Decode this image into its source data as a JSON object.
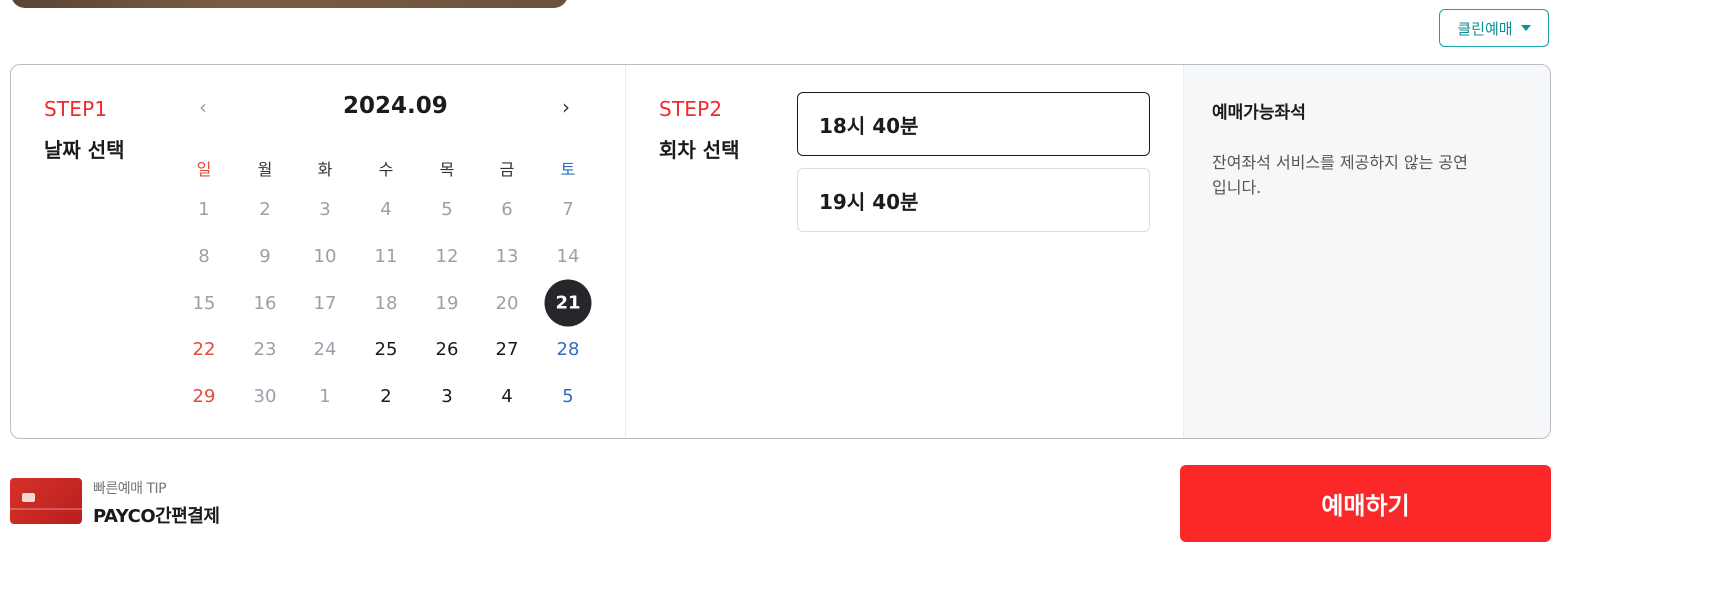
{
  "header": {
    "clean_booking_label": "클린예매"
  },
  "step1": {
    "label": "STEP1",
    "title": "날짜 선택",
    "month": "2024.09",
    "prev_icon": "‹",
    "next_icon": "›",
    "weekdays": [
      "일",
      "월",
      "화",
      "수",
      "목",
      "금",
      "토"
    ],
    "weeks": [
      [
        "1",
        "2",
        "3",
        "4",
        "5",
        "6",
        "7"
      ],
      [
        "8",
        "9",
        "10",
        "11",
        "12",
        "13",
        "14"
      ],
      [
        "15",
        "16",
        "17",
        "18",
        "19",
        "20",
        "21"
      ],
      [
        "22",
        "23",
        "24",
        "25",
        "26",
        "27",
        "28"
      ],
      [
        "29",
        "30",
        "1",
        "2",
        "3",
        "4",
        "5"
      ]
    ],
    "selected_date": "21"
  },
  "step2": {
    "label": "STEP2",
    "title": "회차 선택",
    "times": [
      "18시 40분",
      "19시 40분"
    ],
    "selected_time": "18시 40분"
  },
  "seats": {
    "title": "예매가능좌석",
    "description": "잔여좌석 서비스를 제공하지 않는 공연입니다."
  },
  "tip": {
    "label": "빠른예매 TIP",
    "value": "PAYCO간편결제"
  },
  "book_button_label": "예매하기",
  "colors": {
    "accent_red": "#fa2828",
    "step_red": "#ef2b2b",
    "teal": "#0f8f97",
    "selected_day_bg": "#26262b",
    "sunday": "#e04b3a",
    "saturday": "#2e6fbf"
  }
}
